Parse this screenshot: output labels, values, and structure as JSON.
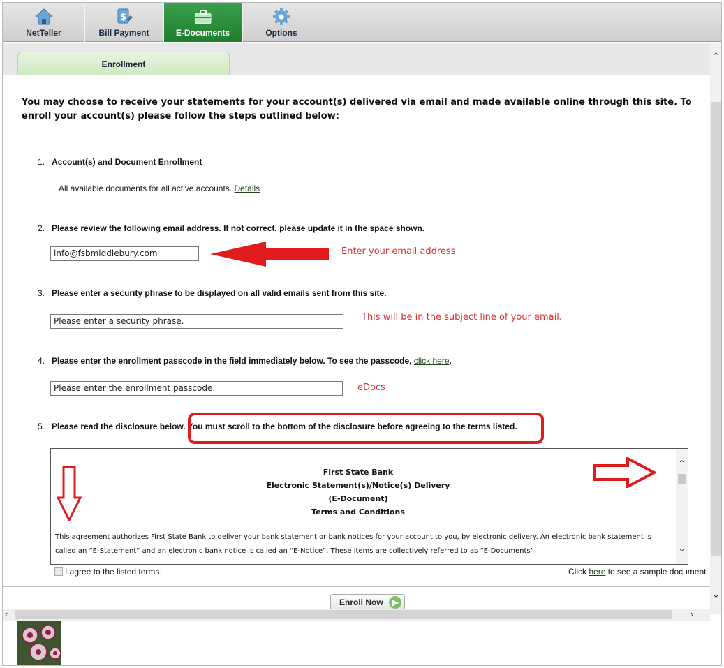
{
  "top_tabs": [
    {
      "label": "NetTeller",
      "icon": "home-icon"
    },
    {
      "label": "Bill Payment",
      "icon": "bill-payment-icon"
    },
    {
      "label": "E-Documents",
      "icon": "briefcase-icon"
    },
    {
      "label": "Options",
      "icon": "gear-icon"
    }
  ],
  "sub_tab": "Enrollment",
  "intro": "You may choose to receive your statements for your account(s) delivered via email and made available online through this site. To enroll your account(s) please follow the steps outlined below:",
  "steps": {
    "s1": {
      "num": "1.",
      "title": "Account(s) and Document Enrollment",
      "note": "All available documents for all active accounts.",
      "link": "Details"
    },
    "s2": {
      "num": "2.",
      "title": "Please review the following email address. If not correct, please update it in the space shown.",
      "value": "info@fsbmiddlebury.com"
    },
    "s3": {
      "num": "3.",
      "title": "Please enter a security phrase to be displayed on all valid emails sent from this site.",
      "placeholder": "Please enter a security phrase."
    },
    "s4": {
      "num": "4.",
      "title": "Please enter the enrollment passcode in the field immediately below. To see the passcode,",
      "link": "click here",
      "placeholder": "Please enter the enrollment passcode."
    },
    "s5": {
      "num": "5.",
      "title_a": "Please read the disclosure below.",
      "title_b": "You must scroll to the bottom of the disclosure before agreeing to the terms listed."
    }
  },
  "annotations": {
    "email": "Enter your email address",
    "phrase": "This will be in the subject line of your email.",
    "passcode": "eDocs"
  },
  "disclosure": {
    "line1": "First State Bank",
    "line2": "Electronic Statement(s)/Notice(s) Delivery",
    "line3": "(E-Document)",
    "line4": "Terms and Conditions",
    "body": "This agreement authorizes First State Bank to deliver your bank statement or bank notices for your account to you, by electronic delivery.  An electronic bank statement is called an “E-Statement” and an electronic bank notice is called an “E-Notice”.  These items are collectively referred to as “E-Documents”."
  },
  "agree_label": "I agree to the listed terms.",
  "sample": {
    "pre": "Click",
    "link": "here",
    "post": "to see a sample document"
  },
  "enroll_button": "Enroll Now",
  "colors": {
    "accent_green": "#2a8c38",
    "annotation_red": "#e01b1b"
  }
}
